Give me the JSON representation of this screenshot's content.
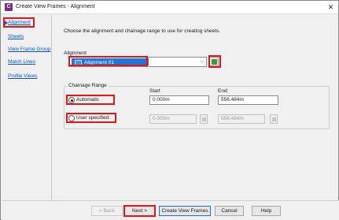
{
  "window": {
    "title": "Create View Frames - Alignment",
    "close_glyph": "✕",
    "app_icon": "civil3d-app-icon",
    "app_icon_letter": "C"
  },
  "sidebar": {
    "items": [
      {
        "label": "Alignment",
        "active": true
      },
      {
        "label": "Sheets"
      },
      {
        "label": "View Frame Group"
      },
      {
        "label": "Match Lines"
      },
      {
        "label": "Profile Views"
      }
    ]
  },
  "main": {
    "intro": "Choose the alignment and chainage range to use for creating sheets.",
    "alignment": {
      "group_label": "Alignment",
      "selected": "Alignment 01",
      "chevron": "⌵",
      "pick_icon": "pick-from-drawing-icon"
    },
    "chainage": {
      "group_label": "Chainage Range",
      "start_label": "Start",
      "end_label": "End:",
      "automatic_label": "Automatic",
      "user_label": "User specified:",
      "auto_start": "0.000m",
      "auto_end": "556.484m",
      "user_start": "0.000m",
      "user_end": "556.484m",
      "selected": "automatic"
    }
  },
  "footer": {
    "back": "< Back",
    "next": "Next >",
    "create": "Create View Frames",
    "cancel": "Cancel",
    "help": "Help"
  },
  "colors": {
    "accent_highlight": "#e3141a",
    "link": "#0b52c8",
    "selection": "#1e76d8"
  }
}
